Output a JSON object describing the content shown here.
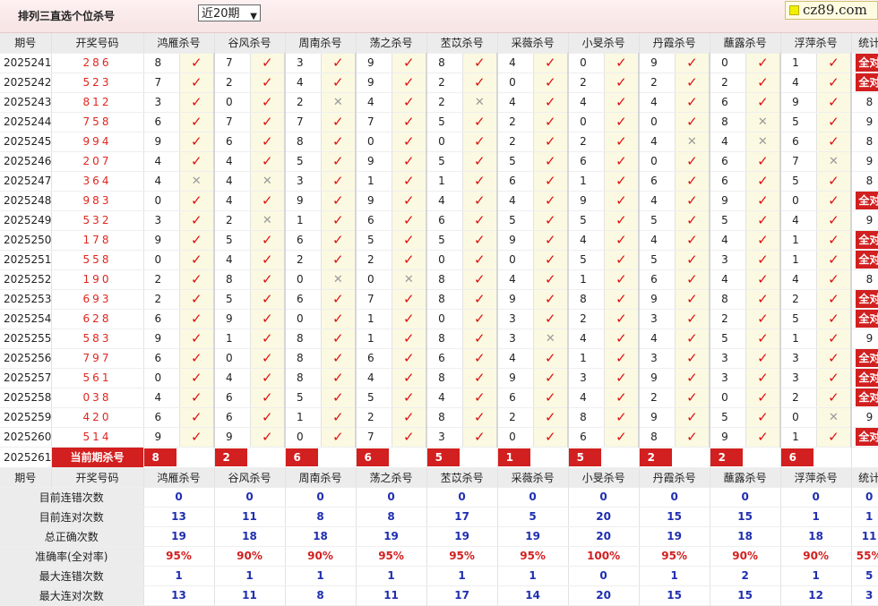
{
  "header": {
    "title": "排列三直选个位杀号",
    "period_select": "近20期",
    "site_logo": "cz89.com"
  },
  "colors": {
    "accent": "#d21f1f",
    "check": "#e01010",
    "cross": "#9a9a9a",
    "blue": "#1f2fb0"
  },
  "columns": {
    "period": "期号",
    "draw": "开奖号码",
    "experts": [
      "鸿雁杀号",
      "谷风杀号",
      "周南杀号",
      "荡之杀号",
      "苤苡杀号",
      "采薇杀号",
      "小旻杀号",
      "丹霞杀号",
      "蘸露杀号",
      "浮萍杀号"
    ],
    "stat": "统计"
  },
  "rows": [
    {
      "period": "2025241",
      "draw": "286",
      "kills": [
        "8",
        "7",
        "3",
        "9",
        "8",
        "4",
        "0",
        "9",
        "0",
        "1"
      ],
      "hits": [
        1,
        1,
        1,
        1,
        1,
        1,
        1,
        1,
        1,
        1
      ],
      "stat": "全对"
    },
    {
      "period": "2025242",
      "draw": "523",
      "kills": [
        "7",
        "2",
        "4",
        "9",
        "2",
        "0",
        "2",
        "2",
        "2",
        "4"
      ],
      "hits": [
        1,
        1,
        1,
        1,
        1,
        1,
        1,
        1,
        1,
        1
      ],
      "stat": "全对"
    },
    {
      "period": "2025243",
      "draw": "812",
      "kills": [
        "3",
        "0",
        "2",
        "4",
        "2",
        "4",
        "4",
        "4",
        "6",
        "9"
      ],
      "hits": [
        1,
        1,
        0,
        1,
        0,
        1,
        1,
        1,
        1,
        1
      ],
      "stat": "8"
    },
    {
      "period": "2025244",
      "draw": "758",
      "kills": [
        "6",
        "7",
        "7",
        "7",
        "5",
        "2",
        "0",
        "0",
        "8",
        "5"
      ],
      "hits": [
        1,
        1,
        1,
        1,
        1,
        1,
        1,
        1,
        0,
        1
      ],
      "stat": "9"
    },
    {
      "period": "2025245",
      "draw": "994",
      "kills": [
        "9",
        "6",
        "8",
        "0",
        "0",
        "2",
        "2",
        "4",
        "4",
        "6"
      ],
      "hits": [
        1,
        1,
        1,
        1,
        1,
        1,
        1,
        0,
        0,
        1
      ],
      "stat": "8"
    },
    {
      "period": "2025246",
      "draw": "207",
      "kills": [
        "4",
        "4",
        "5",
        "9",
        "5",
        "5",
        "6",
        "0",
        "6",
        "7"
      ],
      "hits": [
        1,
        1,
        1,
        1,
        1,
        1,
        1,
        1,
        1,
        0
      ],
      "stat": "9"
    },
    {
      "period": "2025247",
      "draw": "364",
      "kills": [
        "4",
        "4",
        "3",
        "1",
        "1",
        "6",
        "1",
        "6",
        "6",
        "5"
      ],
      "hits": [
        0,
        0,
        1,
        1,
        1,
        1,
        1,
        1,
        1,
        1
      ],
      "stat": "8"
    },
    {
      "period": "2025248",
      "draw": "983",
      "kills": [
        "0",
        "4",
        "9",
        "9",
        "4",
        "4",
        "9",
        "4",
        "9",
        "0"
      ],
      "hits": [
        1,
        1,
        1,
        1,
        1,
        1,
        1,
        1,
        1,
        1
      ],
      "stat": "全对"
    },
    {
      "period": "2025249",
      "draw": "532",
      "kills": [
        "3",
        "2",
        "1",
        "6",
        "6",
        "5",
        "5",
        "5",
        "5",
        "4"
      ],
      "hits": [
        1,
        0,
        1,
        1,
        1,
        1,
        1,
        1,
        1,
        1
      ],
      "stat": "9"
    },
    {
      "period": "2025250",
      "draw": "178",
      "kills": [
        "9",
        "5",
        "6",
        "5",
        "5",
        "9",
        "4",
        "4",
        "4",
        "1"
      ],
      "hits": [
        1,
        1,
        1,
        1,
        1,
        1,
        1,
        1,
        1,
        1
      ],
      "stat": "全对"
    },
    {
      "period": "2025251",
      "draw": "558",
      "kills": [
        "0",
        "4",
        "2",
        "2",
        "0",
        "0",
        "5",
        "5",
        "3",
        "1"
      ],
      "hits": [
        1,
        1,
        1,
        1,
        1,
        1,
        1,
        1,
        1,
        1
      ],
      "stat": "全对"
    },
    {
      "period": "2025252",
      "draw": "190",
      "kills": [
        "2",
        "8",
        "0",
        "0",
        "8",
        "4",
        "1",
        "6",
        "4",
        "4"
      ],
      "hits": [
        1,
        1,
        0,
        0,
        1,
        1,
        1,
        1,
        1,
        1
      ],
      "stat": "8"
    },
    {
      "period": "2025253",
      "draw": "693",
      "kills": [
        "2",
        "5",
        "6",
        "7",
        "8",
        "9",
        "8",
        "9",
        "8",
        "2"
      ],
      "hits": [
        1,
        1,
        1,
        1,
        1,
        1,
        1,
        1,
        1,
        1
      ],
      "stat": "全对"
    },
    {
      "period": "2025254",
      "draw": "628",
      "kills": [
        "6",
        "9",
        "0",
        "1",
        "0",
        "3",
        "2",
        "3",
        "2",
        "5"
      ],
      "hits": [
        1,
        1,
        1,
        1,
        1,
        1,
        1,
        1,
        1,
        1
      ],
      "stat": "全对"
    },
    {
      "period": "2025255",
      "draw": "583",
      "kills": [
        "9",
        "1",
        "8",
        "1",
        "8",
        "3",
        "4",
        "4",
        "5",
        "1"
      ],
      "hits": [
        1,
        1,
        1,
        1,
        1,
        0,
        1,
        1,
        1,
        1
      ],
      "stat": "9"
    },
    {
      "period": "2025256",
      "draw": "797",
      "kills": [
        "6",
        "0",
        "8",
        "6",
        "6",
        "4",
        "1",
        "3",
        "3",
        "3"
      ],
      "hits": [
        1,
        1,
        1,
        1,
        1,
        1,
        1,
        1,
        1,
        1
      ],
      "stat": "全对"
    },
    {
      "period": "2025257",
      "draw": "561",
      "kills": [
        "0",
        "4",
        "8",
        "4",
        "8",
        "9",
        "3",
        "9",
        "3",
        "3"
      ],
      "hits": [
        1,
        1,
        1,
        1,
        1,
        1,
        1,
        1,
        1,
        1
      ],
      "stat": "全对"
    },
    {
      "period": "2025258",
      "draw": "038",
      "kills": [
        "4",
        "6",
        "5",
        "5",
        "4",
        "6",
        "4",
        "2",
        "0",
        "2"
      ],
      "hits": [
        1,
        1,
        1,
        1,
        1,
        1,
        1,
        1,
        1,
        1
      ],
      "stat": "全对"
    },
    {
      "period": "2025259",
      "draw": "420",
      "kills": [
        "6",
        "6",
        "1",
        "2",
        "8",
        "2",
        "8",
        "9",
        "5",
        "0"
      ],
      "hits": [
        1,
        1,
        1,
        1,
        1,
        1,
        1,
        1,
        1,
        0
      ],
      "stat": "9"
    },
    {
      "period": "2025260",
      "draw": "514",
      "kills": [
        "9",
        "9",
        "0",
        "7",
        "3",
        "0",
        "6",
        "8",
        "9",
        "1"
      ],
      "hits": [
        1,
        1,
        1,
        1,
        1,
        1,
        1,
        1,
        1,
        1
      ],
      "stat": "全对"
    }
  ],
  "current": {
    "period": "2025261",
    "label": "当前期杀号",
    "kills": [
      "8",
      "2",
      "6",
      "6",
      "5",
      "1",
      "5",
      "2",
      "2",
      "6"
    ]
  },
  "stats": [
    {
      "label": "目前连错次数",
      "values": [
        "0",
        "0",
        "0",
        "0",
        "0",
        "0",
        "0",
        "0",
        "0",
        "0",
        "0"
      ],
      "red": false
    },
    {
      "label": "目前连对次数",
      "values": [
        "13",
        "11",
        "8",
        "8",
        "17",
        "5",
        "20",
        "15",
        "15",
        "1",
        "1"
      ],
      "red": false
    },
    {
      "label": "总正确次数",
      "values": [
        "19",
        "18",
        "18",
        "19",
        "19",
        "19",
        "20",
        "19",
        "18",
        "18",
        "11"
      ],
      "red": false
    },
    {
      "label": "准确率(全对率)",
      "values": [
        "95%",
        "90%",
        "90%",
        "95%",
        "95%",
        "95%",
        "100%",
        "95%",
        "90%",
        "90%",
        "55%"
      ],
      "red": true
    },
    {
      "label": "最大连错次数",
      "values": [
        "1",
        "1",
        "1",
        "1",
        "1",
        "1",
        "0",
        "1",
        "2",
        "1",
        "5"
      ],
      "red": false
    },
    {
      "label": "最大连对次数",
      "values": [
        "13",
        "11",
        "8",
        "11",
        "17",
        "14",
        "20",
        "15",
        "15",
        "12",
        "3"
      ],
      "red": false
    }
  ]
}
